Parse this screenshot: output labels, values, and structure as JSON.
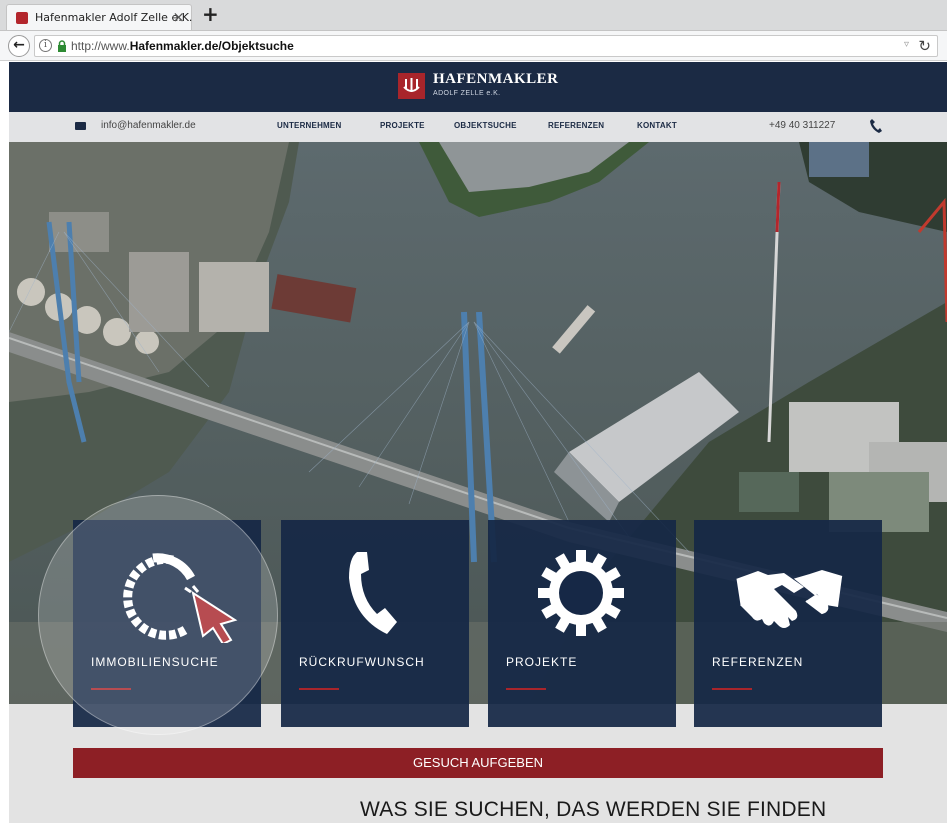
{
  "browser": {
    "tab_title": "Hafenmakler Adolf Zelle e.K.",
    "tab_close": "×",
    "new_tab": "+",
    "url_prefix": "http://www.",
    "url_domain": "Hafenmakler.de",
    "url_path": "/Objektsuche",
    "icons": [
      "back-arrow-icon",
      "info-icon",
      "lock-icon",
      "dropdown-icon",
      "reload-icon"
    ]
  },
  "header": {
    "logo_title": "HAFENMAKLER",
    "logo_sub": "ADOLF ZELLE e.K.",
    "brand_color": "#1b2a44",
    "accent_color": "#a8252b"
  },
  "topnav": {
    "email": "info@hafenmakler.de",
    "links": [
      "UNTERNEHMEN",
      "PROJEKTE",
      "OBJEKTSUCHE",
      "REFERENZEN",
      "KONTAKT"
    ],
    "phone": "+49 40 311227"
  },
  "tiles": [
    {
      "label": "IMMOBILIENSUCHE",
      "icon": "search-cursor-icon"
    },
    {
      "label": "RÜCKRUFWUNSCH",
      "icon": "phone-handset-icon"
    },
    {
      "label": "PROJEKTE",
      "icon": "gear-icon"
    },
    {
      "label": "REFERENZEN",
      "icon": "handshake-icon"
    }
  ],
  "cta": {
    "label": "GESUCH AUFGEBEN"
  },
  "headline": "WAS SIE SUCHEN, DAS WERDEN SIE FINDEN"
}
